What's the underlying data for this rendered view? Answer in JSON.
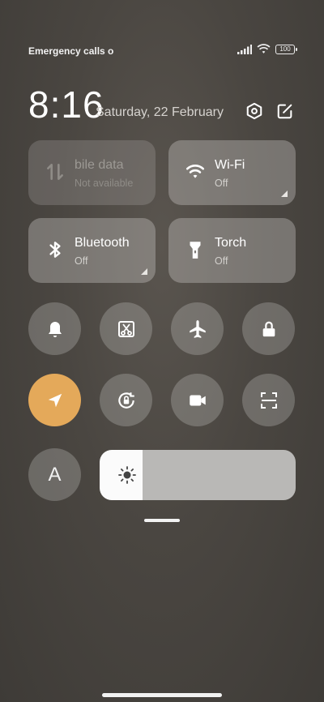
{
  "status": {
    "left_text": "Emergency calls o",
    "battery": "100",
    "icons": [
      "signal-icon",
      "wifi-icon",
      "battery-icon"
    ]
  },
  "header": {
    "time": "8:16",
    "date": "Saturday, 22 February",
    "icons": [
      "settings-icon",
      "edit-icon"
    ]
  },
  "tiles": {
    "mobile_data": {
      "title": "bile data",
      "subtitle": "Not available",
      "enabled": false
    },
    "wifi": {
      "title": "Wi-Fi",
      "subtitle": "Off"
    },
    "bluetooth": {
      "title": "Bluetooth",
      "subtitle": "Off"
    },
    "torch": {
      "title": "Torch",
      "subtitle": "Off"
    }
  },
  "toggles": {
    "row1": [
      "bell-icon",
      "screenshot-icon",
      "airplane-icon",
      "lock-icon"
    ],
    "row2": [
      "location-icon",
      "rotation-lock-icon",
      "video-camera-icon",
      "scan-icon"
    ],
    "active": [
      "location-icon"
    ]
  },
  "auto_brightness": {
    "label": "A"
  },
  "brightness": {
    "level": 0.22
  },
  "colors": {
    "accent": "#e4a95a",
    "background": "#4a4641"
  }
}
